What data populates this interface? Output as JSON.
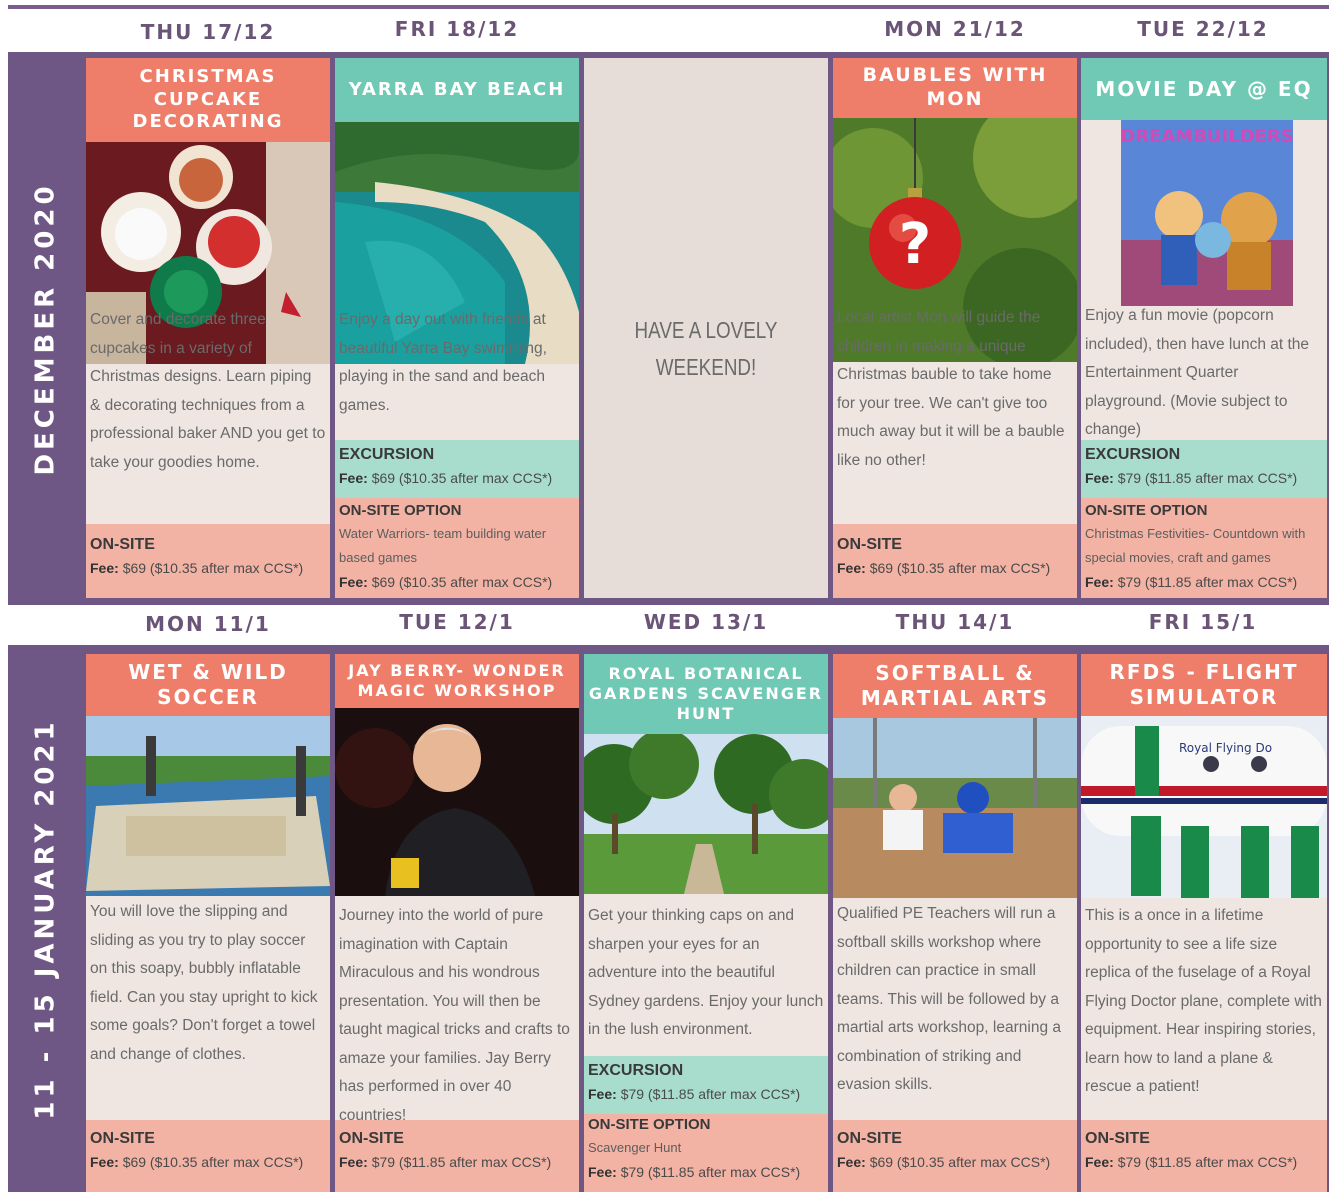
{
  "week1": {
    "label": "DECEMBER 2020",
    "days": [
      {
        "date": "THU 17/12",
        "title": "CHRISTMAS CUPCAKE DECORATING",
        "desc": "Cover and decorate three cupcakes in a variety of Christmas designs. Learn piping & decorating techniques from a professional baker AND you get to take your goodies home.",
        "footer_type": "ON-SITE",
        "footer_fee": "$69 ($10.35 after max CCS*)"
      },
      {
        "date": "FRI 18/12",
        "title": "YARRA BAY BEACH",
        "desc": "Enjoy a day out with friends at beautiful Yarra Bay swimming, playing in the sand and beach games.",
        "excursion_label": "EXCURSION",
        "excursion_fee": "$69 ($10.35 after max CCS*)",
        "option_label": "ON-SITE OPTION",
        "option_desc": "Water Warriors- team building water based games",
        "option_fee": "$69 ($10.35 after max CCS*)"
      },
      {
        "message": "HAVE A LOVELY WEEKEND!"
      },
      {
        "date": "MON 21/12",
        "title": "BAUBLES WITH MON",
        "desc": "Local artist Mon will guide the children in making a unique Christmas bauble to take home for your tree. We can't give too much away but it will be a bauble like no other!",
        "footer_type": "ON-SITE",
        "footer_fee": "$69 ($10.35 after max CCS*)"
      },
      {
        "date": "TUE 22/12",
        "title": "MOVIE DAY @ EQ",
        "poster_text": "DREAMBUILDERS",
        "desc": "Enjoy a fun movie (popcorn included), then have lunch at the Entertainment Quarter playground. (Movie subject to change)",
        "excursion_label": "EXCURSION",
        "excursion_fee": "$79 ($11.85 after max CCS*)",
        "option_label": "ON-SITE OPTION",
        "option_desc": "Christmas Festivities- Countdown with special movies, craft and games",
        "option_fee": "$79 ($11.85 after max CCS*)"
      }
    ]
  },
  "week2": {
    "label": "11 - 15 JANUARY 2021",
    "days": [
      {
        "date": "MON 11/1",
        "title": "WET & WILD SOCCER",
        "desc": "You will love the slipping and sliding as you try to play soccer on this soapy, bubbly inflatable field. Can you stay upright to kick some goals? Don't forget a towel and change of clothes.",
        "footer_type": "ON-SITE",
        "footer_fee": "$69 ($10.35 after max CCS*)"
      },
      {
        "date": "TUE 12/1",
        "title": "JAY BERRY- WONDER MAGIC WORKSHOP",
        "desc": "Journey into the world of pure imagination with Captain Miraculous and his wondrous presentation. You will then be taught magical tricks and crafts to amaze your families. Jay Berry has performed in over 40 countries!",
        "footer_type": "ON-SITE",
        "footer_fee": "$79 ($11.85 after max CCS*)"
      },
      {
        "date": "WED 13/1",
        "title": "ROYAL BOTANICAL GARDENS SCAVENGER HUNT",
        "desc": "Get your thinking caps on and sharpen your eyes for an adventure into the beautiful Sydney gardens. Enjoy your lunch in the lush environment.",
        "excursion_label": "EXCURSION",
        "excursion_fee": "$79 ($11.85 after max CCS*)",
        "option_label": "ON-SITE OPTION",
        "option_desc": "Scavenger Hunt",
        "option_fee": "$79 ($11.85 after max CCS*)"
      },
      {
        "date": "THU 14/1",
        "title": "SOFTBALL & MARTIAL ARTS",
        "desc": "Qualified PE Teachers will run a softball skills workshop where children can practice in small teams. This will be followed by a martial arts workshop, learning a combination of striking and evasion skills.",
        "footer_type": "ON-SITE",
        "footer_fee": "$69 ($10.35 after max CCS*)"
      },
      {
        "date": "FRI 15/1",
        "title": "RFDS - FLIGHT SIMULATOR",
        "plane_text": "Royal Flying Do",
        "desc": "This is a once in a lifetime opportunity to see a life size replica of the fuselage of a Royal Flying Doctor plane, complete with equipment. Hear inspiring stories, learn how to land a plane & rescue a patient!",
        "footer_type": "ON-SITE",
        "footer_fee": "$79 ($11.85 after max CCS*)"
      }
    ]
  },
  "fee_label": "Fee:"
}
